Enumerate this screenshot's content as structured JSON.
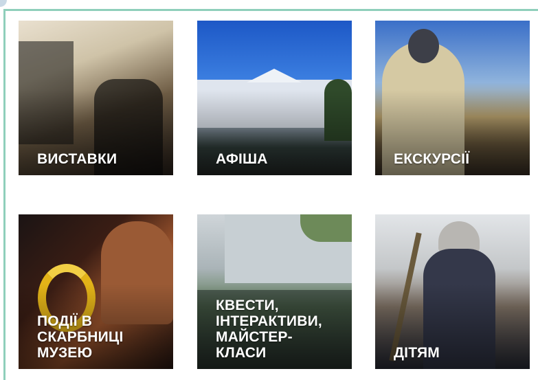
{
  "tiles": [
    {
      "label": "ВИСТАВКИ"
    },
    {
      "label": "АФІША"
    },
    {
      "label": "ЕКСКУРСІЇ"
    },
    {
      "label": "ПОДІЇ В\nСКАРБНИЦІ\nМУЗЕЮ"
    },
    {
      "label": "КВЕСТИ,\nІНТЕРАКТИВИ,\nМАЙСТЕР-\nКЛАСИ"
    },
    {
      "label": "ДІТЯМ"
    }
  ],
  "colors": {
    "frame_border": "#8fcfbb",
    "label_text": "#ffffff"
  }
}
